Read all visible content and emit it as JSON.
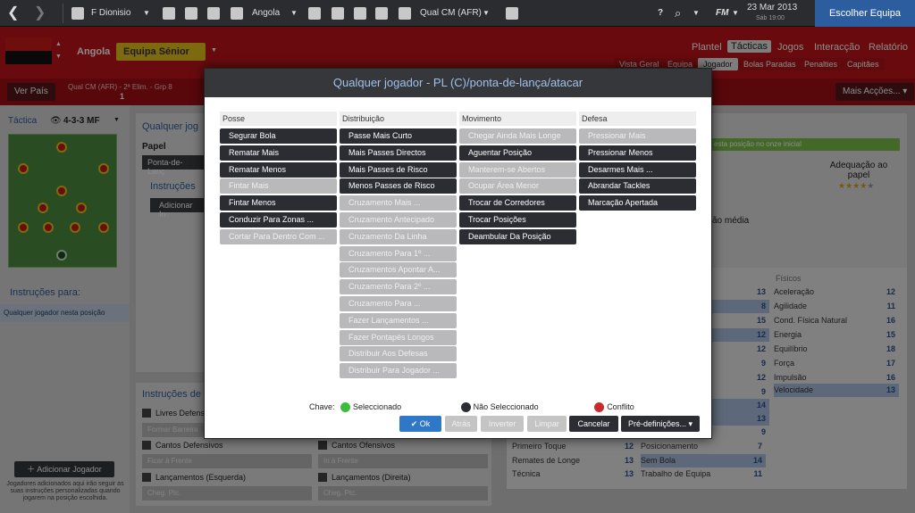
{
  "topbar": {
    "manager": "F Dionisio",
    "nation": "Angola",
    "competition": "Qual CM (AFR)",
    "date": "23 Mar 2013",
    "day_time": "Sáb 19:00",
    "fm": "FM",
    "cta": "Escolher Equipa"
  },
  "header": {
    "club": "Angola",
    "squad": "Equipa Sénior",
    "nav": [
      "Plantel",
      "Tácticas",
      "Jogos",
      "Interacção",
      "Relatório"
    ],
    "tabs": [
      "Vista Geral",
      "Equipa",
      "Jogador",
      "Bolas Paradas",
      "Penalties",
      "Capitães"
    ],
    "ver_pais": "Ver País",
    "competition_info": "Qual CM (AFR) - 2ª Elim. - Grp 8",
    "competition_rank": "1",
    "more_actions": "Mais Acções..."
  },
  "left": {
    "tactic_label": "Táctica",
    "formation": "4-3-3 MF",
    "instructions_for": "Instruções para:",
    "player_item": "Qualquer jogador nesta posição",
    "add_player": "Adicionar Jogador",
    "add_player_note": "Jogadores adicionados aqui irão seguir as suas instruções personalizadas quando jogarem na posição escolhida."
  },
  "bg": {
    "player_title": "Qualquer jog",
    "role_label": "Papel",
    "role_value": "Ponta-de-Lanç",
    "instructions": "Instruções",
    "add_instruction": "Adicionar In",
    "green_note": "esta posição no onze inicial",
    "suitability": "Adequação ao papel",
    "avg": "ão média",
    "instr_title": "Instruções de",
    "left_fields": [
      "Livres Defens",
      "Formar Barreira",
      "Cantos Defensivos",
      "Ficar à Frente",
      "Lançamentos (Esquerda)",
      "Cheg. Ptc."
    ],
    "right_fields": [
      "Cantos Ofensivos",
      "In à Frente",
      "Lançamentos (Direita)",
      "Cheg. Ptc."
    ]
  },
  "attrs": {
    "technical": [
      {
        "name": "Primeiro Toque",
        "val": "12"
      },
      {
        "name": "Remates de Longe",
        "val": "13"
      },
      {
        "name": "Técnica",
        "val": "13"
      }
    ],
    "mental_vals": [
      "13",
      "8",
      "15",
      "12",
      "12",
      "9",
      "12",
      "9",
      "14",
      "13",
      "9"
    ],
    "mental": [
      {
        "name": "Posicionamento",
        "val": "7"
      },
      {
        "name": "Sem Bola",
        "val": "14"
      },
      {
        "name": "Trabalho de Equipa",
        "val": "11"
      }
    ],
    "physical_head": "Físicos",
    "physical": [
      {
        "name": "Aceleração",
        "val": "12"
      },
      {
        "name": "Agilidade",
        "val": "11"
      },
      {
        "name": "Cond. Física Natural",
        "val": "16"
      },
      {
        "name": "Energia",
        "val": "15"
      },
      {
        "name": "Equilíbrio",
        "val": "18"
      },
      {
        "name": "Força",
        "val": "17"
      },
      {
        "name": "Impulsão",
        "val": "16"
      },
      {
        "name": "Velocidade",
        "val": "13"
      }
    ]
  },
  "modal": {
    "title": "Qualquer jogador - PL (C)/ponta-de-lança/atacar",
    "columns": [
      {
        "head": "Posse",
        "items": [
          [
            "Segurar Bola",
            "sel"
          ],
          [
            "Rematar Mais",
            "sel"
          ],
          [
            "Rematar Menos",
            "sel"
          ],
          [
            "Fintar Mais",
            "dis"
          ],
          [
            "Fintar Menos",
            "sel"
          ],
          [
            "Conduzir Para Zonas ...",
            "sel"
          ],
          [
            "Cortar Para Dentro Com ...",
            "dis"
          ]
        ]
      },
      {
        "head": "Distribuição",
        "items": [
          [
            "Passe Mais Curto",
            "sel"
          ],
          [
            "Mais Passes Directos",
            "sel"
          ],
          [
            "Mais Passes de Risco",
            "sel"
          ],
          [
            "Menos Passes de Risco",
            "sel"
          ],
          [
            "Cruzamento Mais ...",
            "dis"
          ],
          [
            "Cruzamento Antecipado",
            "dis"
          ],
          [
            "Cruzamento Da Linha",
            "dis"
          ],
          [
            "Cruzamento Para 1º ...",
            "dis"
          ],
          [
            "Cruzamentos Apontar A...",
            "dis"
          ],
          [
            "Cruzamento Para 2º ...",
            "dis"
          ],
          [
            "Cruzamento Para ...",
            "dis"
          ],
          [
            "Fazer Lançamentos ...",
            "dis"
          ],
          [
            "Fazer Pontapés Longos",
            "dis"
          ],
          [
            "Distribuir Aos Defesas",
            "dis"
          ],
          [
            "Distribuir Para Jogador ...",
            "dis"
          ]
        ]
      },
      {
        "head": "Movimento",
        "items": [
          [
            "Chegar Ainda Mais Longe",
            "dis"
          ],
          [
            "Aguentar Posição",
            "sel"
          ],
          [
            "Manterem-se Abertos",
            "dis"
          ],
          [
            "Ocupar Área Menor",
            "dis"
          ],
          [
            "Trocar de Corredores",
            "sel"
          ],
          [
            "Trocar Posições",
            "sel"
          ],
          [
            "Deambular Da Posição",
            "sel"
          ]
        ]
      },
      {
        "head": "Defesa",
        "items": [
          [
            "Pressionar Mais",
            "dis"
          ],
          [
            "Pressionar Menos",
            "sel"
          ],
          [
            "Desarmes Mais ...",
            "sel"
          ],
          [
            "Abrandar Tackles",
            "sel"
          ],
          [
            "Marcação Apertada",
            "sel"
          ]
        ]
      }
    ],
    "key": {
      "label": "Chave:",
      "selected": "Seleccionado",
      "not_selected": "Não Seleccionado",
      "conflict": "Conflito",
      "c_sel": "#3bbd3b",
      "c_not": "#2b2d33",
      "c_conf": "#cc2a2a"
    },
    "buttons": {
      "ok": "Ok",
      "back": "Atrás",
      "invert": "Inverter",
      "clear": "Limpar",
      "cancel": "Cancelar",
      "presets": "Pré-definições..."
    }
  }
}
